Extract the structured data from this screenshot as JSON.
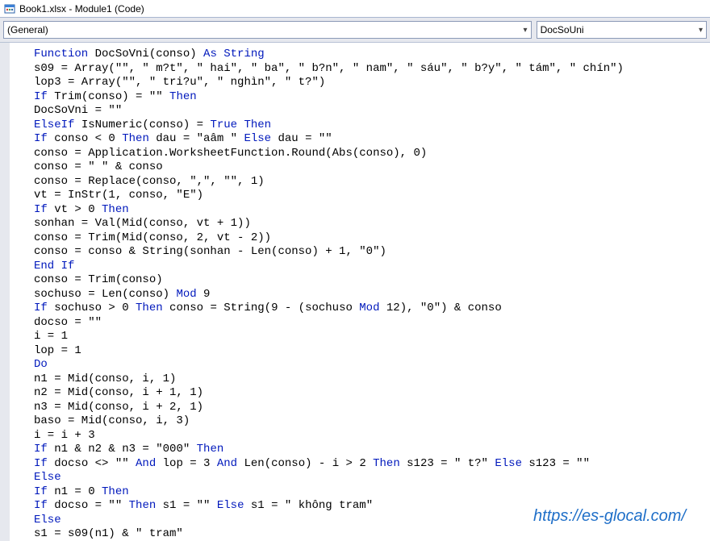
{
  "window": {
    "title": "Book1.xlsx - Module1 (Code)"
  },
  "dropdowns": {
    "left": "(General)",
    "right": "DocSoUni"
  },
  "code": {
    "lines": [
      {
        "segments": [
          {
            "k": true,
            "t": "Function"
          },
          {
            "t": " DocSoVni(conso) "
          },
          {
            "k": true,
            "t": "As String"
          }
        ]
      },
      {
        "segments": [
          {
            "t": "s09 = Array(\"\", \" m?t\", \" hai\", \" ba\", \" b?n\", \" nam\", \" sáu\", \" b?y\", \" tám\", \" chín\")"
          }
        ]
      },
      {
        "segments": [
          {
            "t": "lop3 = Array(\"\", \" tri?u\", \" nghìn\", \" t?\")"
          }
        ]
      },
      {
        "segments": [
          {
            "k": true,
            "t": "If"
          },
          {
            "t": " Trim(conso) = \"\" "
          },
          {
            "k": true,
            "t": "Then"
          }
        ]
      },
      {
        "segments": [
          {
            "t": "DocSoVni = \"\""
          }
        ]
      },
      {
        "segments": [
          {
            "k": true,
            "t": "ElseIf"
          },
          {
            "t": " IsNumeric(conso) = "
          },
          {
            "k": true,
            "t": "True Then"
          }
        ]
      },
      {
        "segments": [
          {
            "k": true,
            "t": "If"
          },
          {
            "t": " conso < 0 "
          },
          {
            "k": true,
            "t": "Then"
          },
          {
            "t": " dau = \"aâm \" "
          },
          {
            "k": true,
            "t": "Else"
          },
          {
            "t": " dau = \"\""
          }
        ]
      },
      {
        "segments": [
          {
            "t": "conso = Application.WorksheetFunction.Round(Abs(conso), 0)"
          }
        ]
      },
      {
        "segments": [
          {
            "t": "conso = \" \" & conso"
          }
        ]
      },
      {
        "segments": [
          {
            "t": "conso = Replace(conso, \",\", \"\", 1)"
          }
        ]
      },
      {
        "segments": [
          {
            "t": "vt = InStr(1, conso, \"E\")"
          }
        ]
      },
      {
        "segments": [
          {
            "k": true,
            "t": "If"
          },
          {
            "t": " vt > 0 "
          },
          {
            "k": true,
            "t": "Then"
          }
        ]
      },
      {
        "segments": [
          {
            "t": "sonhan = Val(Mid(conso, vt + 1))"
          }
        ]
      },
      {
        "segments": [
          {
            "t": "conso = Trim(Mid(conso, 2, vt - 2))"
          }
        ]
      },
      {
        "segments": [
          {
            "t": "conso = conso & String(sonhan - Len(conso) + 1, \"0\")"
          }
        ]
      },
      {
        "segments": [
          {
            "k": true,
            "t": "End If"
          }
        ]
      },
      {
        "segments": [
          {
            "t": "conso = Trim(conso)"
          }
        ]
      },
      {
        "segments": [
          {
            "t": "sochuso = Len(conso) "
          },
          {
            "k": true,
            "t": "Mod"
          },
          {
            "t": " 9"
          }
        ]
      },
      {
        "segments": [
          {
            "k": true,
            "t": "If"
          },
          {
            "t": " sochuso > 0 "
          },
          {
            "k": true,
            "t": "Then"
          },
          {
            "t": " conso = String(9 - (sochuso "
          },
          {
            "k": true,
            "t": "Mod"
          },
          {
            "t": " 12), \"0\") & conso"
          }
        ]
      },
      {
        "segments": [
          {
            "t": "docso = \"\""
          }
        ]
      },
      {
        "segments": [
          {
            "t": "i = 1"
          }
        ]
      },
      {
        "segments": [
          {
            "t": "lop = 1"
          }
        ]
      },
      {
        "segments": [
          {
            "k": true,
            "t": "Do"
          }
        ]
      },
      {
        "segments": [
          {
            "t": "n1 = Mid(conso, i, 1)"
          }
        ]
      },
      {
        "segments": [
          {
            "t": "n2 = Mid(conso, i + 1, 1)"
          }
        ]
      },
      {
        "segments": [
          {
            "t": "n3 = Mid(conso, i + 2, 1)"
          }
        ]
      },
      {
        "segments": [
          {
            "t": "baso = Mid(conso, i, 3)"
          }
        ]
      },
      {
        "segments": [
          {
            "t": "i = i + 3"
          }
        ]
      },
      {
        "segments": [
          {
            "k": true,
            "t": "If"
          },
          {
            "t": " n1 & n2 & n3 = \"000\" "
          },
          {
            "k": true,
            "t": "Then"
          }
        ]
      },
      {
        "segments": [
          {
            "k": true,
            "t": "If"
          },
          {
            "t": " docso <> \"\" "
          },
          {
            "k": true,
            "t": "And"
          },
          {
            "t": " lop = 3 "
          },
          {
            "k": true,
            "t": "And"
          },
          {
            "t": " Len(conso) - i > 2 "
          },
          {
            "k": true,
            "t": "Then"
          },
          {
            "t": " s123 = \" t?\" "
          },
          {
            "k": true,
            "t": "Else"
          },
          {
            "t": " s123 = \"\""
          }
        ]
      },
      {
        "segments": [
          {
            "k": true,
            "t": "Else"
          }
        ]
      },
      {
        "segments": [
          {
            "k": true,
            "t": "If"
          },
          {
            "t": " n1 = 0 "
          },
          {
            "k": true,
            "t": "Then"
          }
        ]
      },
      {
        "segments": [
          {
            "k": true,
            "t": "If"
          },
          {
            "t": " docso = \"\" "
          },
          {
            "k": true,
            "t": "Then"
          },
          {
            "t": " s1 = \"\" "
          },
          {
            "k": true,
            "t": "Else"
          },
          {
            "t": " s1 = \" không tram\""
          }
        ]
      },
      {
        "segments": [
          {
            "k": true,
            "t": "Else"
          }
        ]
      },
      {
        "segments": [
          {
            "t": "s1 = s09(n1) & \" tram\""
          }
        ]
      }
    ]
  },
  "watermark": "https://es-glocal.com/"
}
